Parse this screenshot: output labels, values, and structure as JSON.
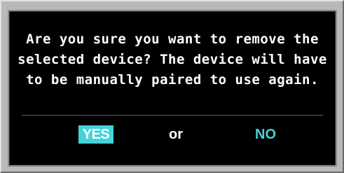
{
  "dialog": {
    "message_lines": [
      "Are you sure you want to remove the",
      "selected device? The device will have",
      "to be manually paired to use again."
    ],
    "yes_label": "YES",
    "or_label": "or",
    "no_label": "NO"
  },
  "colors": {
    "highlight": "#43d3d9",
    "text": "#ffffff",
    "background": "#000000",
    "frame": "#b9b9b9"
  }
}
